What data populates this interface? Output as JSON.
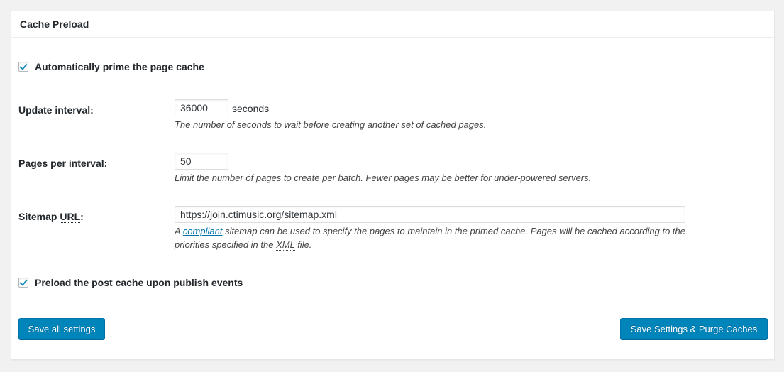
{
  "panel": {
    "title": "Cache Preload"
  },
  "auto_prime": {
    "checked": true,
    "label": "Automatically prime the page cache"
  },
  "update_interval": {
    "label": "Update interval:",
    "value": "36000",
    "unit": "seconds",
    "description": "The number of seconds to wait before creating another set of cached pages."
  },
  "pages_per_interval": {
    "label": "Pages per interval:",
    "value": "50",
    "description": "Limit the number of pages to create per batch. Fewer pages may be better for under-powered servers."
  },
  "sitemap": {
    "label_prefix": "Sitemap ",
    "label_abbr": "URL",
    "label_suffix": ":",
    "value": "https://join.ctimusic.org/sitemap.xml",
    "description_line1_prefix": "A ",
    "description_link": "compliant",
    "description_line1_suffix": " sitemap can be used to specify the pages to maintain in the primed cache. Pages will be cached according to the",
    "description_line2_prefix": "priorities specified in the ",
    "description_abbr": "XML",
    "description_line2_suffix": " file."
  },
  "preload_post": {
    "checked": true,
    "label": "Preload the post cache upon publish events"
  },
  "buttons": {
    "save_all": "Save all settings",
    "save_purge": "Save Settings & Purge Caches"
  },
  "colors": {
    "primary_button": "#0085ba",
    "link": "#0073aa",
    "checkmark": "#1e8cbe"
  }
}
